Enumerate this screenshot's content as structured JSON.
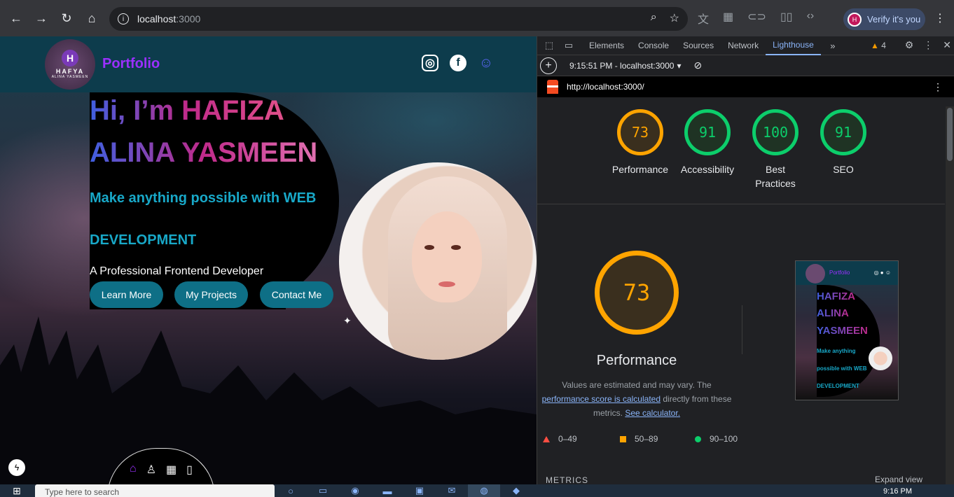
{
  "browser": {
    "url_host": "localhost",
    "url_port": ":3000",
    "verify_label": "Verify it's you",
    "avatar_letter": "H"
  },
  "site": {
    "logo_letter": "H",
    "logo_name": "HAFYA",
    "logo_sub": "ALINA YASMEEN",
    "brand": "Portfolio",
    "heading_line1": "Hi, I’m HAFIZA",
    "heading_line2": "ALINA YASMEEN",
    "subtitle_line1": "Make anything possible with WEB",
    "subtitle_line2": "DEVELOPMENT",
    "role": "A Professional Frontend Developer",
    "buttons": [
      "Learn More",
      "My Projects",
      "Contact Me"
    ],
    "social_icons": [
      "instagram-icon",
      "facebook-icon",
      "discord-icon"
    ],
    "bottom_nav_icons": [
      "home-icon",
      "user-icon",
      "grid-icon",
      "clipboard-icon"
    ]
  },
  "devtools": {
    "tabs": [
      "Elements",
      "Console",
      "Sources",
      "Network",
      "Lighthouse"
    ],
    "active_tab": "Lighthouse",
    "warning_count": "4",
    "report_time": "9:15:51 PM - localhost:3000",
    "report_url": "http://localhost:3000/",
    "scores": [
      {
        "label": "Performance",
        "value": "73",
        "color": "#ffa400"
      },
      {
        "label": "Accessibility",
        "value": "91",
        "color": "#0cce6b"
      },
      {
        "label": "Best Practices",
        "value": "100",
        "color": "#0cce6b"
      },
      {
        "label": "SEO",
        "value": "91",
        "color": "#0cce6b"
      }
    ],
    "perf_big_score": "73",
    "perf_title": "Performance",
    "perf_desc_a": "Values are estimated and may vary. The",
    "perf_desc_link1": "performance score is calculated",
    "perf_desc_b": "directly from these metrics.",
    "perf_desc_link2": "See calculator.",
    "legend": [
      "0–49",
      "50–89",
      "90–100"
    ],
    "metrics_label": "METRICS",
    "expand_label": "Expand view",
    "thumb": {
      "brand": "Portfolio",
      "title1": "HAFIZA",
      "title2": "ALINA",
      "title3": "YASMEEN",
      "sub1": "Make anything",
      "sub2": "possible with WEB",
      "sub3": "DEVELOPMENT"
    }
  },
  "taskbar": {
    "search_placeholder": "Type here to search",
    "clock": "9:16 PM"
  }
}
